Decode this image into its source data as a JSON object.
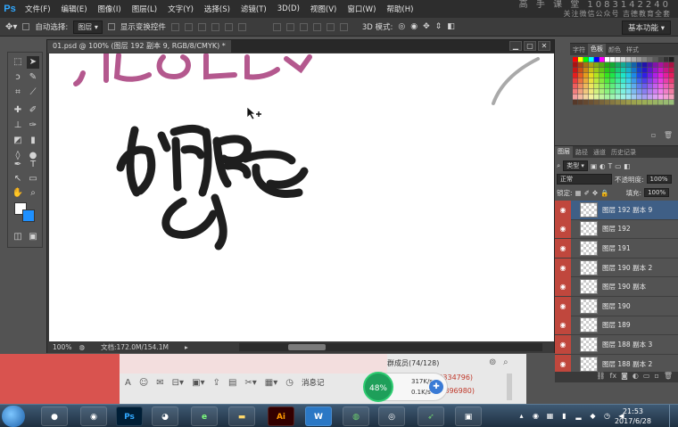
{
  "menubar": {
    "logo": "Ps",
    "items": [
      "文件(F)",
      "编辑(E)",
      "图像(I)",
      "图层(L)",
      "文字(Y)",
      "选择(S)",
      "滤镜(T)",
      "3D(D)",
      "视图(V)",
      "窗口(W)",
      "帮助(H)"
    ],
    "watermark_line1": "高 手 课 堂  1083142240",
    "watermark_line2": "关注微信公众号  吉德教育全套"
  },
  "options": {
    "auto_select_label": "自动选择:",
    "auto_select_value": "图层",
    "show_transform_label": "显示变换控件",
    "mode3d_label": "3D 模式:",
    "workspace": "基本功能"
  },
  "document": {
    "tab_title": "01.psd @ 100% (图层 192 副本 9, RGB/8/CMYK) *",
    "zoom": "100%",
    "doc_info": "文档:172.0M/154.1M"
  },
  "swatches": {
    "tabs": [
      "字符",
      "色板",
      "颜色",
      "样式"
    ],
    "active_tab": "色板"
  },
  "layers": {
    "tabs": [
      "图层",
      "路径",
      "通道",
      "历史记录"
    ],
    "active_tab": "图层",
    "filter_kind": "类型",
    "blend_mode": "正常",
    "opacity_label": "不透明度:",
    "opacity": "100%",
    "lock_label": "锁定:",
    "fill_label": "填充:",
    "fill": "100%",
    "items": [
      {
        "name": "图层 192 副本 9",
        "selected": true
      },
      {
        "name": "图层 192",
        "selected": false
      },
      {
        "name": "图层 191",
        "selected": false
      },
      {
        "name": "图层 190 副本 2",
        "selected": false
      },
      {
        "name": "图层 190 副本",
        "selected": false
      },
      {
        "name": "图层 190",
        "selected": false
      },
      {
        "name": "图层 189",
        "selected": false
      },
      {
        "name": "图层 188 副本 3",
        "selected": false
      },
      {
        "name": "图层 188 副本 2",
        "selected": false
      }
    ]
  },
  "chat": {
    "group_members": "群成员(74/128)",
    "number1": "(863334796)",
    "number2": "2163896980)",
    "message_record": "消息记",
    "net_percent": "48%",
    "upload_speed": "317K/s",
    "download_speed": "0.1K/s"
  },
  "taskbar": {
    "apps": [
      "Ps",
      "Ai",
      "W"
    ],
    "time": "21:53",
    "date": "2017/6/28"
  },
  "colors": {
    "ps_blue": "#31a8ff",
    "layer_visibility_red": "#c0473d",
    "background_swatch": "#1e90ff",
    "artwork_pink": "#b4588e",
    "artwork_dark": "#1e1e1e"
  }
}
